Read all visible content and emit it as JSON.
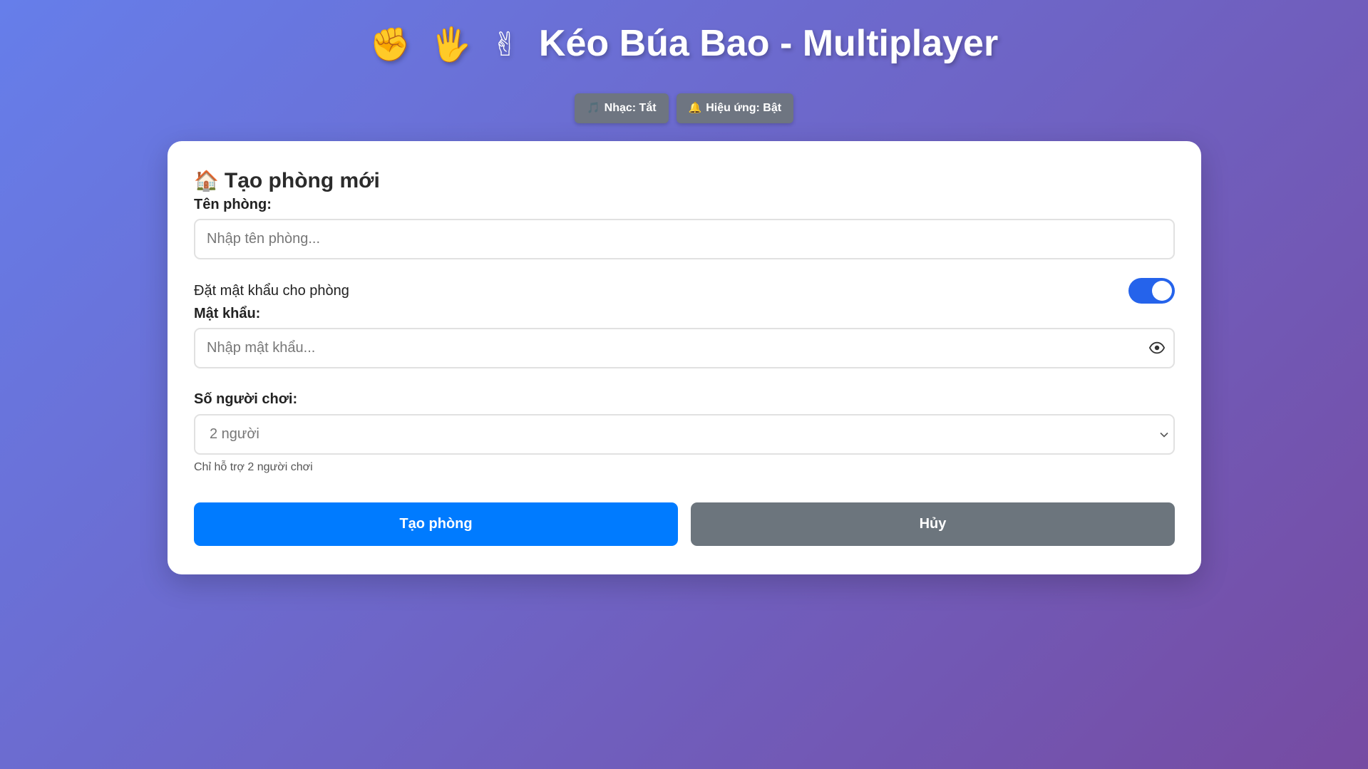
{
  "header": {
    "hands": [
      "✊",
      "🖐",
      "✌"
    ],
    "title": "Kéo Búa Bao - Multiplayer"
  },
  "toggles": {
    "music": {
      "icon": "🎵",
      "label": "Nhạc: Tắt"
    },
    "effects": {
      "icon": "🔔",
      "label": "Hiệu ứng: Bật"
    }
  },
  "form": {
    "icon": "🏠",
    "title": "Tạo phòng mới",
    "room_name_label": "Tên phòng:",
    "room_name_placeholder": "Nhập tên phòng...",
    "room_name_value": "",
    "password_toggle_label": "Đặt mật khẩu cho phòng",
    "password_toggle_on": true,
    "password_label": "Mật khẩu:",
    "password_placeholder": "Nhập mật khẩu...",
    "password_value": "",
    "players_label": "Số người chơi:",
    "players_selected": "2 người",
    "players_hint": "Chỉ hỗ trợ 2 người chơi",
    "create_button": "Tạo phòng",
    "cancel_button": "Hủy"
  },
  "colors": {
    "gradient_start": "#667eea",
    "gradient_end": "#764ba2",
    "primary": "#007bff",
    "secondary": "#6c757d",
    "toggle_on": "#2563eb"
  },
  "icons": {
    "eye": "eye-icon",
    "select_arrow": "chevron-down-icon"
  }
}
